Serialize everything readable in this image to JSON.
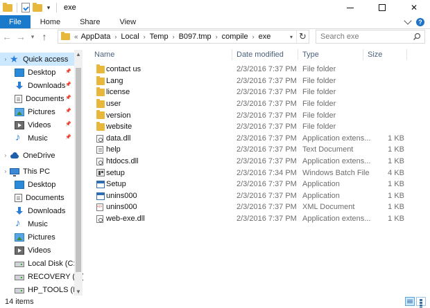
{
  "window": {
    "title": "exe",
    "controls": {
      "minimize": "min-icon",
      "maximize": "max-icon",
      "close": "✕"
    }
  },
  "ribbon": {
    "tabs": [
      {
        "label": "File"
      },
      {
        "label": "Home"
      },
      {
        "label": "Share"
      },
      {
        "label": "View"
      }
    ],
    "help_glyph": "?"
  },
  "address": {
    "lead": "«",
    "crumbs": [
      "AppData",
      "Local",
      "Temp",
      "B097.tmp",
      "compile",
      "exe"
    ],
    "search_placeholder": "Search exe"
  },
  "nav": {
    "items": [
      {
        "label": "Quick access",
        "icon": "star-icon",
        "selected": true,
        "pinned": false,
        "indent": false
      },
      {
        "label": "Desktop",
        "icon": "desktop-icon",
        "pinned": true,
        "indent": true
      },
      {
        "label": "Downloads",
        "icon": "download-icon",
        "pinned": true,
        "indent": true
      },
      {
        "label": "Documents",
        "icon": "documents-icon",
        "pinned": true,
        "indent": true
      },
      {
        "label": "Pictures",
        "icon": "pictures-icon",
        "pinned": true,
        "indent": true
      },
      {
        "label": "Videos",
        "icon": "videos-icon",
        "pinned": true,
        "indent": true
      },
      {
        "label": "Music",
        "icon": "music-icon",
        "pinned": true,
        "indent": true
      },
      {
        "label": "OneDrive",
        "icon": "onedrive-icon",
        "pinned": false,
        "indent": false
      },
      {
        "label": "This PC",
        "icon": "this-pc-icon",
        "pinned": false,
        "indent": false
      },
      {
        "label": "Desktop",
        "icon": "desktop-icon",
        "pinned": false,
        "indent": true
      },
      {
        "label": "Documents",
        "icon": "documents-icon",
        "pinned": false,
        "indent": true
      },
      {
        "label": "Downloads",
        "icon": "download-icon",
        "pinned": false,
        "indent": true
      },
      {
        "label": "Music",
        "icon": "music-icon",
        "pinned": false,
        "indent": true
      },
      {
        "label": "Pictures",
        "icon": "pictures-icon",
        "pinned": false,
        "indent": true
      },
      {
        "label": "Videos",
        "icon": "videos-icon",
        "pinned": false,
        "indent": true
      },
      {
        "label": "Local Disk (C:)",
        "icon": "drive-icon",
        "pinned": false,
        "indent": true
      },
      {
        "label": "RECOVERY (E:)",
        "icon": "drive-icon",
        "pinned": false,
        "indent": true
      },
      {
        "label": "HP_TOOLS (F:)",
        "icon": "drive-icon",
        "pinned": false,
        "indent": true
      }
    ]
  },
  "columns": {
    "name": "Name",
    "date": "Date modified",
    "type": "Type",
    "size": "Size"
  },
  "files": [
    {
      "name": "contact us",
      "date": "2/3/2016 7:37 PM",
      "type": "File folder",
      "size": "",
      "icon": "folder-icon"
    },
    {
      "name": "Lang",
      "date": "2/3/2016 7:37 PM",
      "type": "File folder",
      "size": "",
      "icon": "folder-icon"
    },
    {
      "name": "license",
      "date": "2/3/2016 7:37 PM",
      "type": "File folder",
      "size": "",
      "icon": "folder-icon"
    },
    {
      "name": "user",
      "date": "2/3/2016 7:37 PM",
      "type": "File folder",
      "size": "",
      "icon": "folder-icon"
    },
    {
      "name": "version",
      "date": "2/3/2016 7:37 PM",
      "type": "File folder",
      "size": "",
      "icon": "folder-icon"
    },
    {
      "name": "website",
      "date": "2/3/2016 7:37 PM",
      "type": "File folder",
      "size": "",
      "icon": "folder-icon"
    },
    {
      "name": "data.dll",
      "date": "2/3/2016 7:37 PM",
      "type": "Application extens...",
      "size": "1 KB",
      "icon": "dll-icon"
    },
    {
      "name": "help",
      "date": "2/3/2016 7:37 PM",
      "type": "Text Document",
      "size": "1 KB",
      "icon": "text-document-icon"
    },
    {
      "name": "htdocs.dll",
      "date": "2/3/2016 7:37 PM",
      "type": "Application extens...",
      "size": "1 KB",
      "icon": "dll-icon"
    },
    {
      "name": "setup",
      "date": "2/3/2016 7:34 PM",
      "type": "Windows Batch File",
      "size": "4 KB",
      "icon": "batch-file-icon"
    },
    {
      "name": "Setup",
      "date": "2/3/2016 7:37 PM",
      "type": "Application",
      "size": "1 KB",
      "icon": "application-icon"
    },
    {
      "name": "unins000",
      "date": "2/3/2016 7:37 PM",
      "type": "Application",
      "size": "1 KB",
      "icon": "application-icon"
    },
    {
      "name": "unins000",
      "date": "2/3/2016 7:37 PM",
      "type": "XML Document",
      "size": "1 KB",
      "icon": "xml-document-icon"
    },
    {
      "name": "web-exe.dll",
      "date": "2/3/2016 7:37 PM",
      "type": "Application extens...",
      "size": "1 KB",
      "icon": "dll-icon"
    }
  ],
  "status": {
    "count": "14 items"
  },
  "colors": {
    "accent": "#1979ca",
    "selection": "#cce8ff",
    "folder": "#e8b83c",
    "header_text": "#4c607a",
    "secondary_text": "#6d6d6d"
  }
}
